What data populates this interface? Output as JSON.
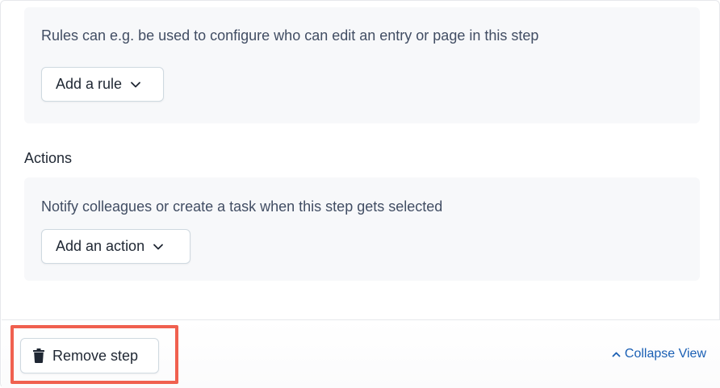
{
  "rules": {
    "description": "Rules can e.g. be used to configure who can edit an entry or page in this step",
    "add_button_label": "Add a rule",
    "add_button_icon": "chevron-down-icon"
  },
  "actions": {
    "heading": "Actions",
    "description": "Notify colleagues or create a task when this step gets selected",
    "add_button_label": "Add an action",
    "add_button_icon": "chevron-down-icon"
  },
  "footer": {
    "remove_label": "Remove step",
    "remove_icon": "trash-icon",
    "collapse_label": "Collapse View",
    "collapse_icon": "chevron-up-icon"
  },
  "colors": {
    "highlight": "#f0604f",
    "link": "#1a5fb4",
    "panel_bg": "#f7f8fa"
  }
}
